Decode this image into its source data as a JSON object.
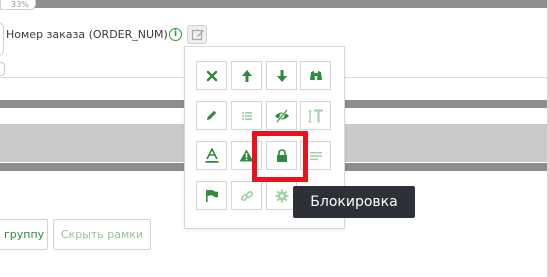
{
  "page": {
    "zoom_label": "33%",
    "field_label": "Номер заказа (ORDER_NUM)"
  },
  "toolbar_popup": {
    "rows": [
      [
        {
          "icon": "close-icon",
          "label": "Удалить",
          "color": "#2e8b3e"
        },
        {
          "icon": "arrow-up-icon",
          "label": "Вверх",
          "color": "#2e8b3e"
        },
        {
          "icon": "arrow-down-icon",
          "label": "Вниз",
          "color": "#2e8b3e"
        },
        {
          "icon": "binoculars-icon",
          "label": "Поиск",
          "color": "#2e8b3e"
        }
      ],
      [
        {
          "icon": "pencil-icon",
          "label": "Редактировать",
          "color": "#2e8b3e"
        },
        {
          "icon": "list-icon",
          "label": "Список",
          "color": "#9fd0a6"
        },
        {
          "icon": "eye-hidden-icon",
          "label": "Скрыть",
          "color": "#2e8b3e"
        },
        {
          "icon": "text-size-icon",
          "label": "Размер текста",
          "color": "#9fd0a6"
        }
      ],
      [
        {
          "icon": "text-underline-icon",
          "label": "Подчеркивание",
          "color": "#2e8b3e"
        },
        {
          "icon": "warning-icon",
          "label": "Предупреждение",
          "color": "#2e8b3e"
        },
        {
          "icon": "lock-icon",
          "label": "Блокировка",
          "color": "#2e8b3e"
        },
        {
          "icon": "lines-icon",
          "label": "Строки",
          "color": "#9fd0a6"
        }
      ],
      [
        {
          "icon": "flag-icon",
          "label": "Флаг",
          "color": "#2e8b3e"
        },
        {
          "icon": "link-icon",
          "label": "Ссылка",
          "color": "#9fd0a6"
        },
        {
          "icon": "gear-icon",
          "label": "Настройки",
          "color": "#9fd0a6"
        }
      ]
    ]
  },
  "tooltip": {
    "text": "Блокировка"
  },
  "buttons": {
    "group_label": "группу",
    "hide_frames_label": "Скрыть рамки"
  },
  "colors": {
    "accent_green": "#2e8b3e",
    "faded_green": "#9fd0a6",
    "highlight_red": "#e8131d",
    "tooltip_bg": "#2d3036"
  }
}
